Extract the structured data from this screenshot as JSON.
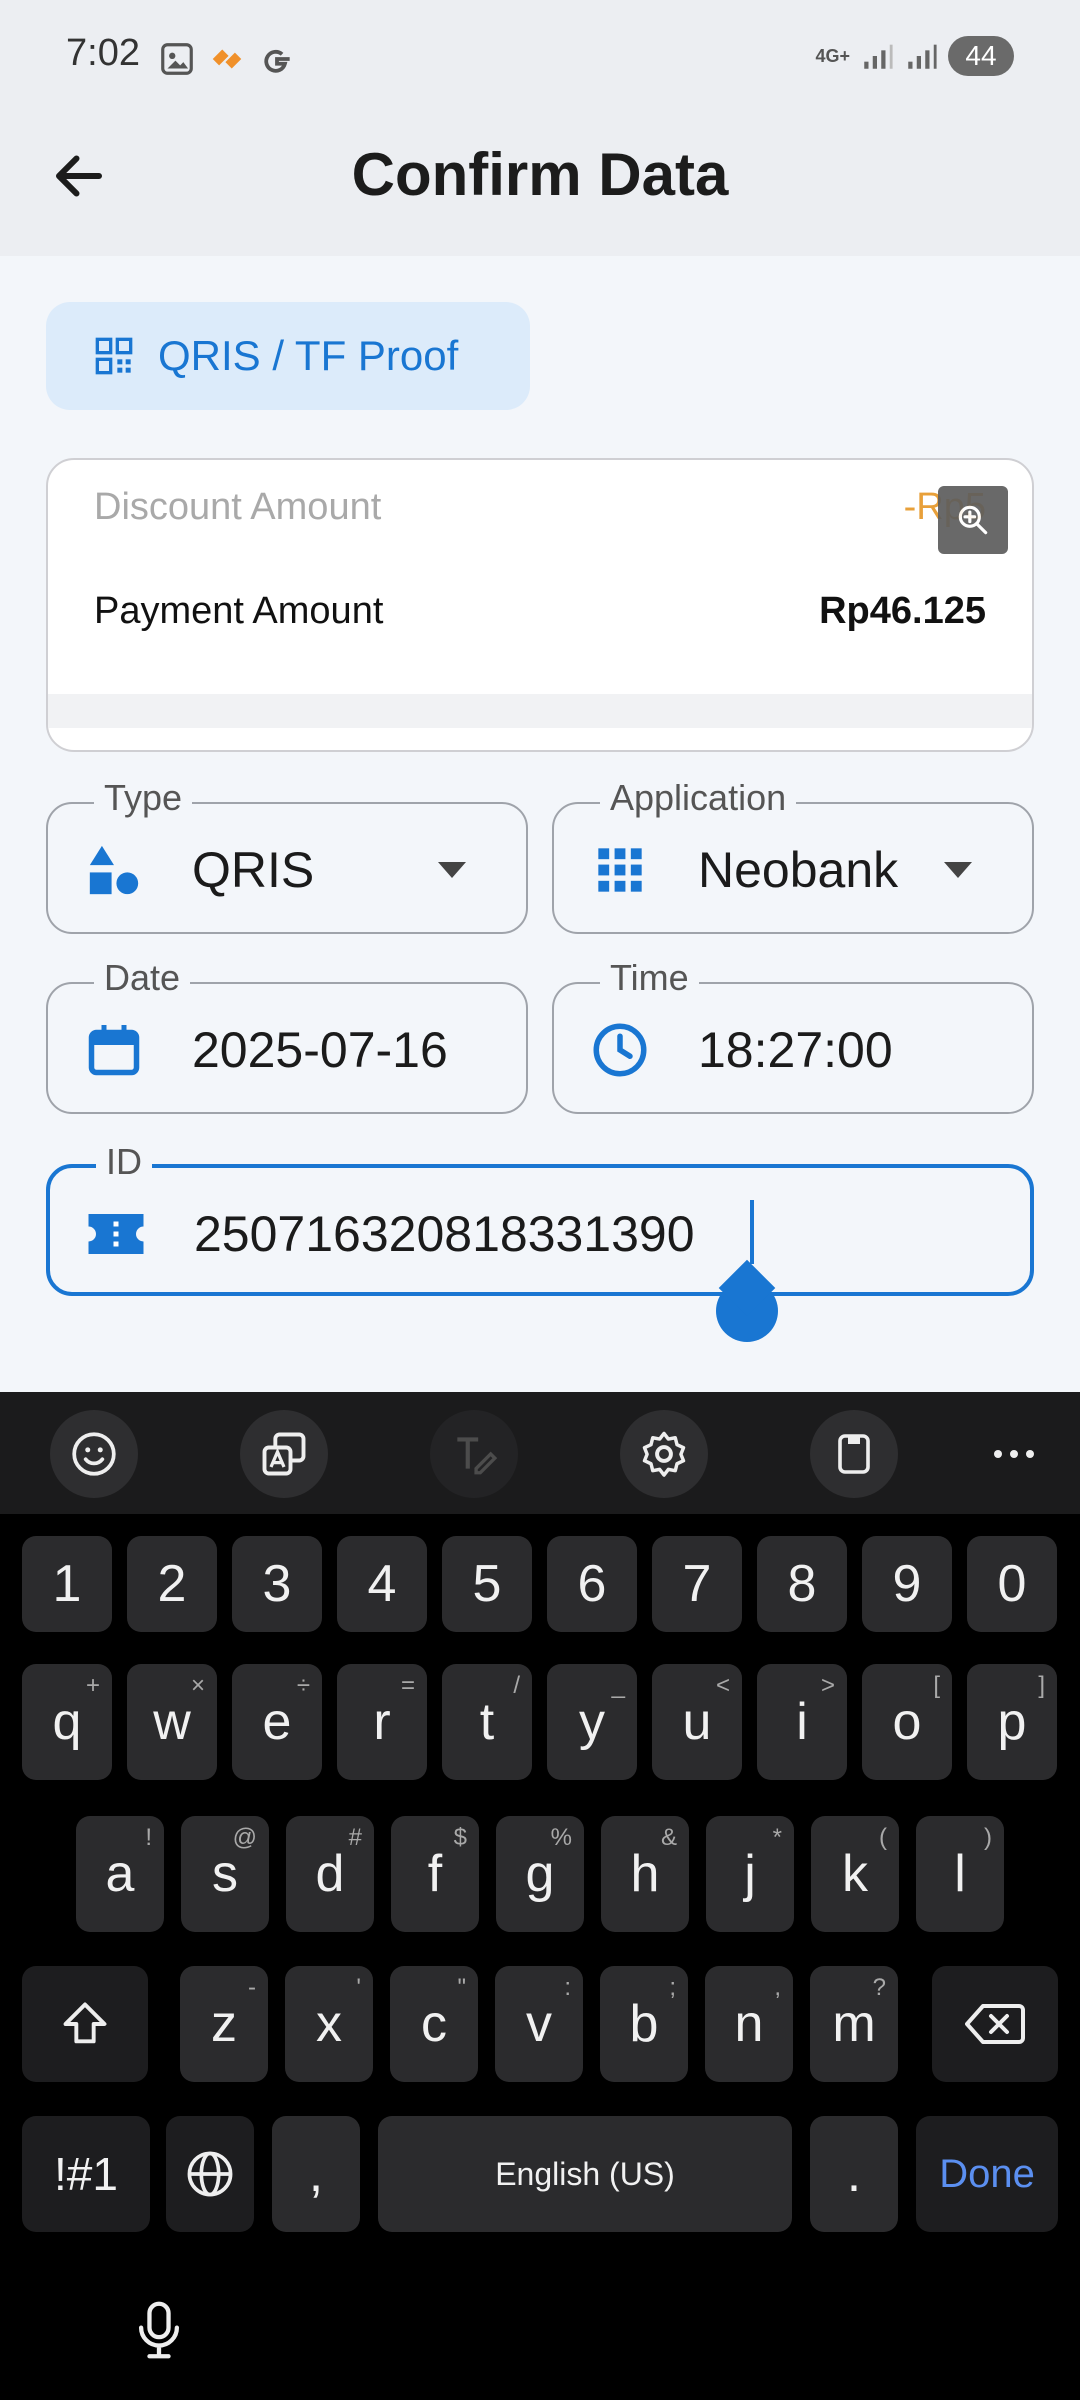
{
  "status_bar": {
    "time": "7:02",
    "network": "4G+",
    "battery": "44"
  },
  "header": {
    "title": "Confirm Data",
    "back_icon": "arrow-left-icon"
  },
  "proof_button": {
    "label": "QRIS / TF Proof",
    "icon": "qr-code-icon"
  },
  "amounts": {
    "discount_label": "Discount Amount",
    "discount_value": "-Rp5",
    "payment_label": "Payment Amount",
    "payment_value": "Rp46.125"
  },
  "fields": {
    "type": {
      "label": "Type",
      "value": "QRIS",
      "icon": "shapes-icon"
    },
    "application": {
      "label": "Application",
      "value": "Neobank",
      "icon": "grid-icon"
    },
    "date": {
      "label": "Date",
      "value": "2025-07-16",
      "icon": "calendar-icon"
    },
    "time": {
      "label": "Time",
      "value": "18:27:00",
      "icon": "clock-icon"
    },
    "id": {
      "label": "ID",
      "value": "250716320818331390",
      "icon": "ticket-icon"
    }
  },
  "keyboard": {
    "toolbar": [
      "emoji-icon",
      "translate-icon",
      "handwriting-icon",
      "settings-icon",
      "clipboard-icon",
      "more-icon"
    ],
    "row_numbers": [
      "1",
      "2",
      "3",
      "4",
      "5",
      "6",
      "7",
      "8",
      "9",
      "0"
    ],
    "row_1": [
      {
        "k": "q",
        "h": "+"
      },
      {
        "k": "w",
        "h": "×"
      },
      {
        "k": "e",
        "h": "÷"
      },
      {
        "k": "r",
        "h": "="
      },
      {
        "k": "t",
        "h": "/"
      },
      {
        "k": "y",
        "h": "_"
      },
      {
        "k": "u",
        "h": "<"
      },
      {
        "k": "i",
        "h": ">"
      },
      {
        "k": "o",
        "h": "["
      },
      {
        "k": "p",
        "h": "]"
      }
    ],
    "row_2": [
      {
        "k": "a",
        "h": "!"
      },
      {
        "k": "s",
        "h": "@"
      },
      {
        "k": "d",
        "h": "#"
      },
      {
        "k": "f",
        "h": "$"
      },
      {
        "k": "g",
        "h": "%"
      },
      {
        "k": "h",
        "h": "&"
      },
      {
        "k": "j",
        "h": "*"
      },
      {
        "k": "k",
        "h": "("
      },
      {
        "k": "l",
        "h": ")"
      }
    ],
    "row_3": [
      {
        "k": "z",
        "h": "-"
      },
      {
        "k": "x",
        "h": "'"
      },
      {
        "k": "c",
        "h": "\""
      },
      {
        "k": "v",
        "h": ":"
      },
      {
        "k": "b",
        "h": ";"
      },
      {
        "k": "n",
        "h": ","
      },
      {
        "k": "m",
        "h": "?"
      }
    ],
    "symbols_label": "!#1",
    "comma": ",",
    "space_label": "English (US)",
    "period": ".",
    "done_label": "Done"
  }
}
